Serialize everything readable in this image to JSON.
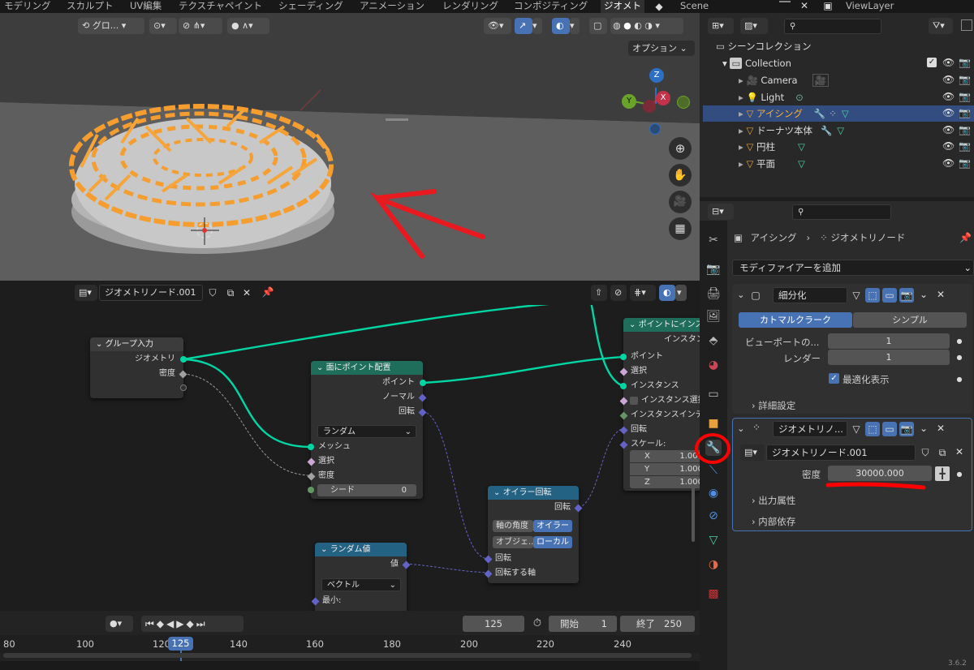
{
  "workspace_tabs": [
    "モデリング",
    "スカルプト",
    "UV編集",
    "テクスチャペイント",
    "シェーディング",
    "アニメーション",
    "レンダリング",
    "コンポジティング",
    "ジオメト"
  ],
  "scene": {
    "name": "Scene",
    "view_layer": "ViewLayer"
  },
  "viewport": {
    "transform_orientation": "グロ...",
    "options_label": "オプション",
    "gizmo": {
      "z": "Z",
      "x": "X",
      "y": "Y"
    }
  },
  "node_editor": {
    "tree_name": "ジオメトリノード.001",
    "group_input": {
      "title": "グループ入力",
      "outputs": [
        "ジオメトリ",
        "密度"
      ]
    },
    "distribute": {
      "title": "面にポイント配置",
      "outputs": [
        "ポイント",
        "ノーマル",
        "回転"
      ],
      "mode": "ランダム",
      "inputs": [
        "メッシュ",
        "選択",
        "密度"
      ],
      "seed_label": "シード",
      "seed_value": "0"
    },
    "instance": {
      "title": "ポイントにインスタンス",
      "output": "インスタンス",
      "inputs": [
        "ポイント",
        "選択",
        "インスタンス",
        "インスタンス選択",
        "インスタンスインデックス",
        "回転",
        "スケール:"
      ],
      "scale": [
        {
          "axis": "X",
          "value": "1.000"
        },
        {
          "axis": "Y",
          "value": "1.000"
        },
        {
          "axis": "Z",
          "value": "1.000"
        }
      ]
    },
    "euler": {
      "title": "オイラー回転",
      "output": "回転",
      "row1": {
        "label": "軸の角度",
        "value": "オイラー"
      },
      "row2": {
        "label": "オブジェ...",
        "value": "ローカル"
      },
      "inputs": [
        "回転",
        "回転する軸"
      ]
    },
    "random": {
      "title": "ランダム値",
      "output": "値",
      "type": "ベクトル",
      "min_label": "最小:"
    }
  },
  "timeline": {
    "current": "125",
    "start_label": "開始",
    "start": "1",
    "end_label": "終了",
    "end": "250",
    "ruler": [
      "80",
      "100",
      "120",
      "140",
      "160",
      "180",
      "200",
      "220",
      "240"
    ]
  },
  "outliner": {
    "root": "シーンコレクション",
    "collection": "Collection",
    "items": [
      {
        "name": "Camera",
        "selected": false
      },
      {
        "name": "Light",
        "selected": false
      },
      {
        "name": "アイシング",
        "selected": true
      },
      {
        "name": "ドーナツ本体",
        "selected": false
      },
      {
        "name": "円柱",
        "selected": false
      },
      {
        "name": "平面",
        "selected": false
      }
    ]
  },
  "properties": {
    "breadcrumb_object": "アイシング",
    "breadcrumb_modifier": "ジオメトリノード",
    "add_modifier": "モディファイアーを追加",
    "subdivision": {
      "name": "細分化",
      "mode_a": "カトマルクラーク",
      "mode_b": "シンプル",
      "viewport_label": "ビューポートの...",
      "viewport_value": "1",
      "render_label": "レンダー",
      "render_value": "1",
      "optimal_label": "最適化表示",
      "advanced_label": "詳細設定"
    },
    "geonodes": {
      "name": "ジオメトリノ...",
      "tree": "ジオメトリノード.001",
      "density_label": "密度",
      "density_value": "30000.000",
      "output_attrs": "出力属性",
      "internal_deps": "内部依存"
    }
  },
  "status": {
    "version": "3.6.2"
  },
  "colors": {
    "accent": "#4772b3",
    "selection": "#334d80",
    "annotation": "#ff0000",
    "wire_geometry": "#00d6a3"
  }
}
